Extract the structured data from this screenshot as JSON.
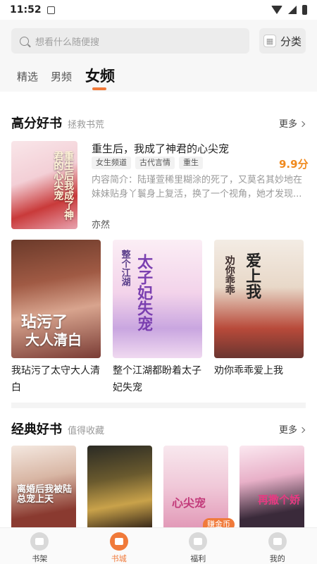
{
  "status_bar": {
    "time": "11:52"
  },
  "search": {
    "placeholder": "想看什么随便搜"
  },
  "category_button": {
    "label": "分类"
  },
  "tabs": [
    {
      "label": "精选"
    },
    {
      "label": "男频"
    },
    {
      "label": "女频",
      "active": true
    }
  ],
  "section_high": {
    "title": "高分好书",
    "subtitle": "拯救书荒",
    "more": "更多",
    "featured": {
      "title": "重生后，我成了神君的心尖宠",
      "tags": [
        "女生频道",
        "古代言情",
        "重生"
      ],
      "score": "9.9分",
      "summary_line1": "内容简介：陆瑾萱稀里糊涂的死了，又莫名其妙地在",
      "summary_line2": "妹妹贴身丫鬟身上复活，换了一个视角，她才发现...",
      "author": "亦然",
      "cover_text": "重生后我成了神君的心尖宠"
    },
    "books": [
      {
        "title_line1": "我玷污了太守大人清",
        "title_line2": "白",
        "cover_text_1": "玷污了",
        "cover_text_2": "大人清白"
      },
      {
        "title_line1": "整个江湖都盼着太子",
        "title_line2": "妃失宠",
        "cover_text_1": "整个江湖",
        "cover_text_2": "太子妃失宠"
      },
      {
        "title_line1": "劝你乖乖爱上我",
        "title_line2": "",
        "cover_text_1": "劝你乖乖",
        "cover_text_2": "爱上我"
      }
    ]
  },
  "section_classic": {
    "title": "经典好书",
    "subtitle": "值得收藏",
    "more": "更多",
    "covers": [
      {
        "text": "离婚后我被陆总宠上天"
      },
      {
        "text": ""
      },
      {
        "text": "心尖宠"
      },
      {
        "text": "再撒个娇"
      }
    ],
    "badge": "赚金币"
  },
  "bottom_nav": [
    {
      "label": "书架"
    },
    {
      "label": "书城",
      "active": true
    },
    {
      "label": "福利"
    },
    {
      "label": "我的"
    }
  ],
  "colors": {
    "accent": "#f07a3a",
    "score": "#f08a1e"
  }
}
